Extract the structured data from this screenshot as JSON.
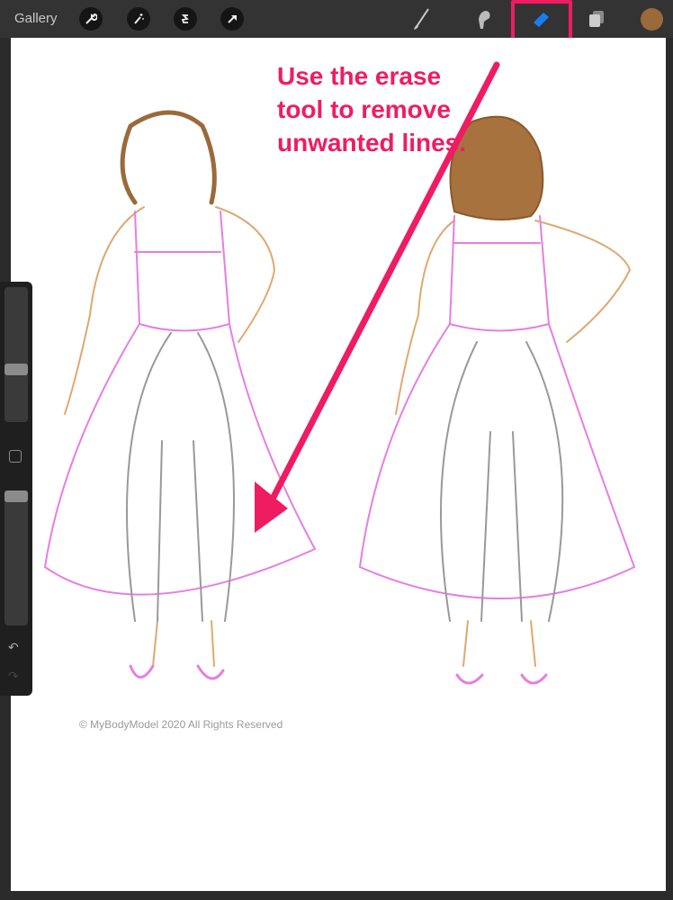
{
  "toolbar": {
    "gallery_label": "Gallery",
    "left_tools": [
      "wrench-icon",
      "magic-wand-icon",
      "selection-icon",
      "transform-arrow-icon"
    ],
    "right_tools": [
      "brush-icon",
      "smudge-icon",
      "eraser-icon",
      "layers-icon"
    ],
    "active_tool": "eraser",
    "active_color": "#9a6a3a",
    "highlight_color": "#ef1c62"
  },
  "sidebar": {
    "brush_size_level": 0.6,
    "opacity_level": 0.0,
    "undo_icon": "undo-icon",
    "redo_icon": "redo-icon"
  },
  "canvas": {
    "annotation": "Use the erase tool to remove unwanted lines.",
    "copyright": "© MyBodyModel 2020 All Rights Reserved"
  }
}
